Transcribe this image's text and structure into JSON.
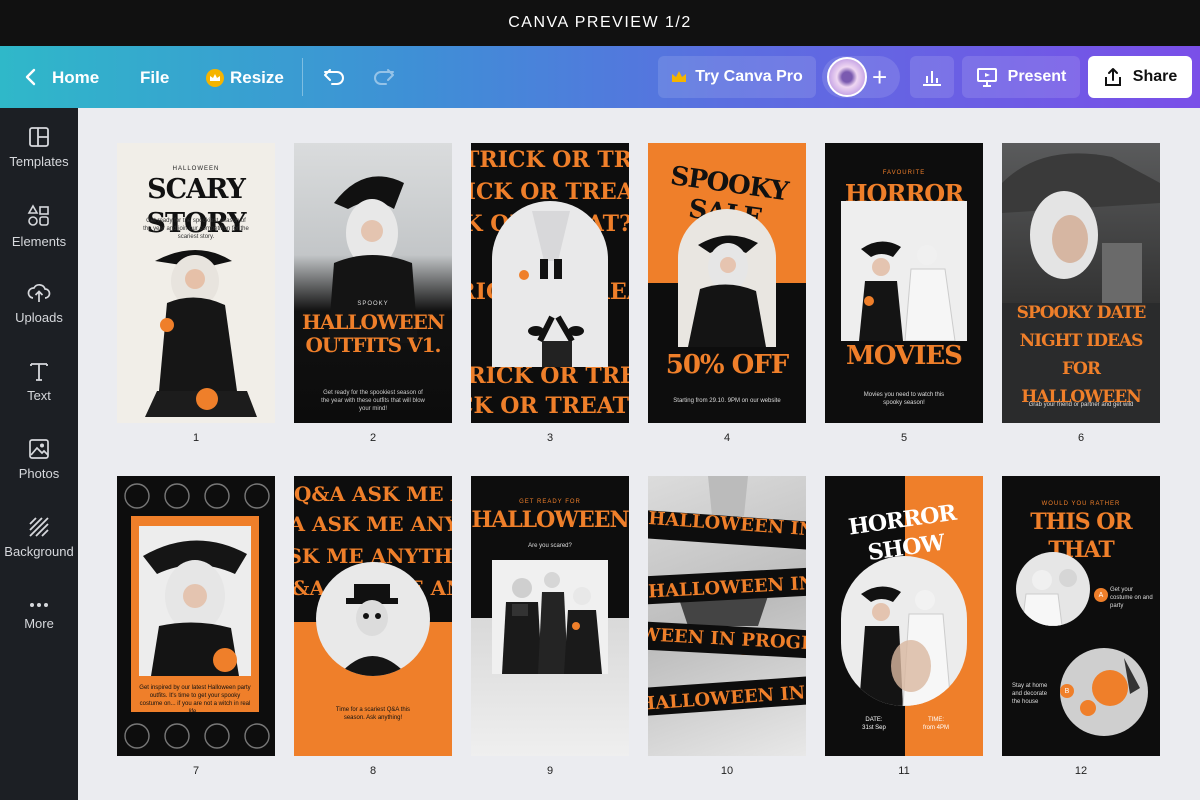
{
  "window": {
    "title": "CANVA PREVIEW 1/2"
  },
  "toolbar": {
    "home_label": "Home",
    "file_label": "File",
    "resize_label": "Resize",
    "try_pro_label": "Try Canva Pro",
    "present_label": "Present",
    "share_label": "Share",
    "plus_glyph": "+"
  },
  "sidebar": {
    "items": [
      {
        "label": "Templates",
        "icon": "templates-icon"
      },
      {
        "label": "Elements",
        "icon": "elements-icon"
      },
      {
        "label": "Uploads",
        "icon": "uploads-icon"
      },
      {
        "label": "Text",
        "icon": "text-icon"
      },
      {
        "label": "Photos",
        "icon": "photos-icon"
      },
      {
        "label": "Background",
        "icon": "background-icon"
      },
      {
        "label": "More",
        "icon": "more-icon"
      }
    ]
  },
  "colors": {
    "orange": "#ef7f2a",
    "black": "#0d0d0d",
    "cream": "#f1eee8",
    "canvas": "#ebecf0",
    "sidebar": "#1c1f24"
  },
  "pages": [
    {
      "number": "1",
      "small_top": "HALLOWEEN",
      "title": "SCARY STORY",
      "body": "Get ready for the spookiest season of the year and join our competition for the scariest story."
    },
    {
      "number": "2",
      "small_top": "SPOOKY",
      "title": "HALLOWEEN OUTFITS V1.",
      "body": "Get ready for the spookiest season of the year with these outfits that will blow your mind!"
    },
    {
      "number": "3",
      "title": "TRICK OR TREAT?"
    },
    {
      "number": "4",
      "title": "SPOOKY SALE",
      "discount": "50% OFF",
      "body": "Starting from 29.10. 9PM on our website"
    },
    {
      "number": "5",
      "small_top": "FAVOURITE",
      "title": "HORROR",
      "subtitle": "MOVIES",
      "body": "Movies you need to watch this spooky season!"
    },
    {
      "number": "6",
      "title": "SPOOKY DATE NIGHT IDEAS FOR HALLOWEEN",
      "body": "Grab your friend or partner and get wild"
    },
    {
      "number": "7",
      "body": "Get inspired by our latest Halloween party outfits. It's time to get your spooky costume on... if you are not a witch in real life..."
    },
    {
      "number": "8",
      "title": "Q&A ASK ME ANYTHING",
      "body": "Time for a scariest Q&A this season. Ask anything!"
    },
    {
      "number": "9",
      "small_top": "GET READY FOR",
      "title": "HALLOWEEN",
      "body": "Are you scared?"
    },
    {
      "number": "10",
      "title": "HALLOWEEN IN PROGRESS"
    },
    {
      "number": "11",
      "title": "HORROR SHOW",
      "date_label": "DATE:",
      "date_value": "31st Sep",
      "time_label": "TIME:",
      "time_value": "from 4PM"
    },
    {
      "number": "12",
      "small_top": "WOULD YOU RATHER",
      "title": "THIS OR THAT",
      "option_a_badge": "A",
      "option_a": "Get your costume on and party",
      "option_b_badge": "B",
      "option_b": "Stay at home and decorate the house"
    }
  ]
}
